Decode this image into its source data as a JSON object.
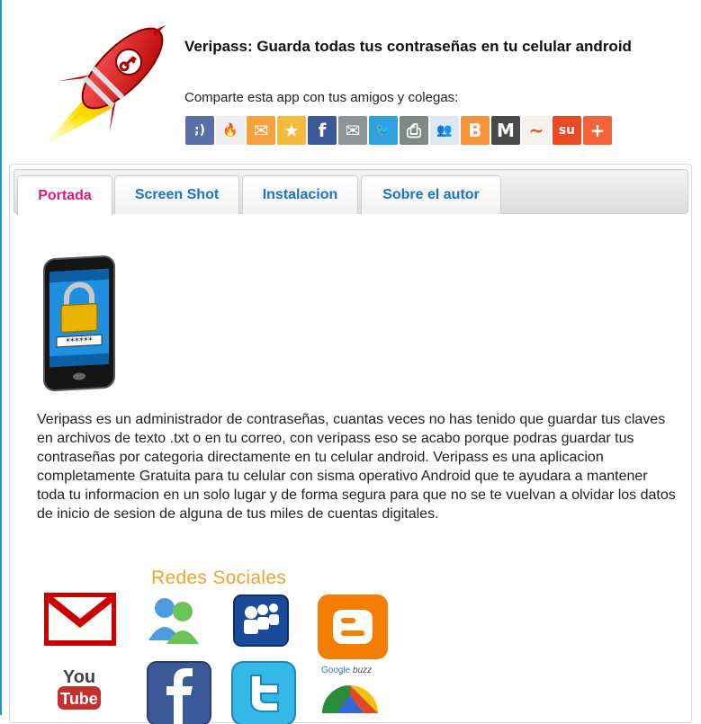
{
  "header": {
    "title": "Veripass: Guarda todas tus contraseñas en tu celular android",
    "share_text": "Comparte esta app con tus amigos y colegas:",
    "share_icons": [
      {
        "name": "myspace-wink-icon",
        "color": "#5a6fa8",
        "glyph": ";)"
      },
      {
        "name": "fire-icon",
        "color": "#eeeeee",
        "glyph": "🔥"
      },
      {
        "name": "email-icon",
        "color": "#f6a23c",
        "glyph": "✉"
      },
      {
        "name": "favorite-star-icon",
        "color": "#f6b93c",
        "glyph": "★"
      },
      {
        "name": "facebook-icon",
        "color": "#3b5998",
        "glyph": "f"
      },
      {
        "name": "mail-icon",
        "color": "#8d959b",
        "glyph": "✉"
      },
      {
        "name": "twitter-icon",
        "color": "#2fa3e2",
        "glyph": "🐦"
      },
      {
        "name": "print-icon",
        "color": "#7f8a86",
        "glyph": "⎙"
      },
      {
        "name": "messenger-icon",
        "color": "#dde7f2",
        "glyph": "👥"
      },
      {
        "name": "blogger-icon",
        "color": "#f59338",
        "glyph": "B"
      },
      {
        "name": "gmail-icon",
        "color": "#4a4a4a",
        "glyph": "M"
      },
      {
        "name": "sketch-icon",
        "color": "#f4f1ea",
        "glyph": "~"
      },
      {
        "name": "stumbleupon-icon",
        "color": "#eb4924",
        "glyph": "su"
      },
      {
        "name": "add-more-icon",
        "color": "#f4623a",
        "glyph": "+"
      }
    ]
  },
  "tabs": [
    {
      "label": "Portada",
      "active": true
    },
    {
      "label": "Screen Shot",
      "active": false
    },
    {
      "label": "Instalacion",
      "active": false
    },
    {
      "label": "Sobre el autor",
      "active": false
    }
  ],
  "main": {
    "description": "Veripass es un administrador de contraseñas, cuantas veces no has tenido que guardar tus claves en archivos de texto .txt o en tu correo, con veripass eso se acabo porque podras guardar tus contraseñas por categoria directamente en tu celular android. Veripass es una aplicacion completamente Gratuita para tu celular con sisma operativo Android que te ayudara a mantener toda tu informacion en un solo lugar y de forma segura para que no se te vuelvan a olvidar los datos de inicio de sesion de alguna de tus miles de cuentas digitales.",
    "phone_password_text": "******",
    "redes_title": "Redes Sociales",
    "social_icons": [
      "gmail-icon",
      "messenger-icon",
      "myspace-icon",
      "blogger-icon",
      "youtube-icon",
      "facebook-icon",
      "twitter-icon",
      "google-buzz-icon"
    ],
    "youtube_text": {
      "you": "You",
      "tube": "Tube"
    },
    "gbuzz_text": {
      "google": "Google",
      "buzz": "buzz"
    }
  },
  "colors": {
    "active_tab": "#e2187b",
    "tab_text": "#1a73c9",
    "redes_title": "#f2a22a",
    "page_border": "#2a8fd6"
  }
}
